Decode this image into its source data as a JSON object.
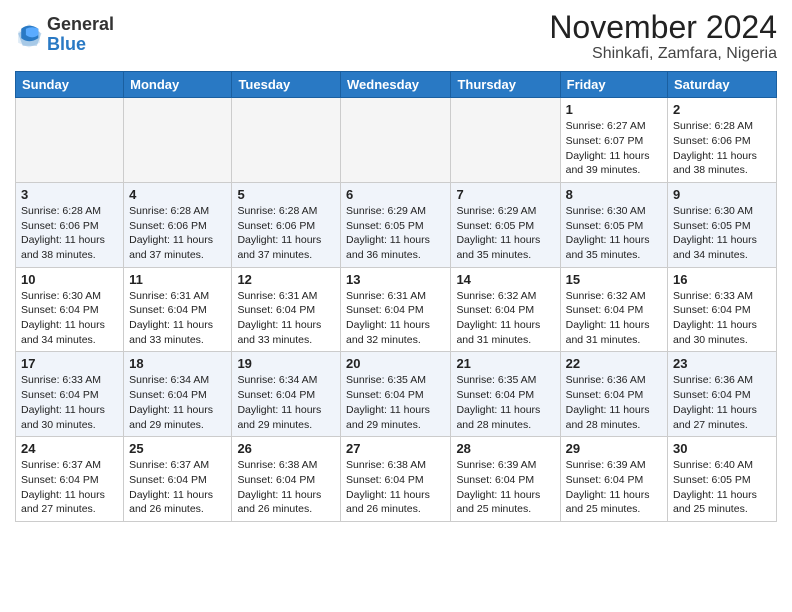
{
  "header": {
    "logo_general": "General",
    "logo_blue": "Blue",
    "month_year": "November 2024",
    "location": "Shinkafi, Zamfara, Nigeria"
  },
  "weekdays": [
    "Sunday",
    "Monday",
    "Tuesday",
    "Wednesday",
    "Thursday",
    "Friday",
    "Saturday"
  ],
  "weeks": [
    [
      {
        "day": "",
        "info": ""
      },
      {
        "day": "",
        "info": ""
      },
      {
        "day": "",
        "info": ""
      },
      {
        "day": "",
        "info": ""
      },
      {
        "day": "",
        "info": ""
      },
      {
        "day": "1",
        "info": "Sunrise: 6:27 AM\nSunset: 6:07 PM\nDaylight: 11 hours and 39 minutes."
      },
      {
        "day": "2",
        "info": "Sunrise: 6:28 AM\nSunset: 6:06 PM\nDaylight: 11 hours and 38 minutes."
      }
    ],
    [
      {
        "day": "3",
        "info": "Sunrise: 6:28 AM\nSunset: 6:06 PM\nDaylight: 11 hours and 38 minutes."
      },
      {
        "day": "4",
        "info": "Sunrise: 6:28 AM\nSunset: 6:06 PM\nDaylight: 11 hours and 37 minutes."
      },
      {
        "day": "5",
        "info": "Sunrise: 6:28 AM\nSunset: 6:06 PM\nDaylight: 11 hours and 37 minutes."
      },
      {
        "day": "6",
        "info": "Sunrise: 6:29 AM\nSunset: 6:05 PM\nDaylight: 11 hours and 36 minutes."
      },
      {
        "day": "7",
        "info": "Sunrise: 6:29 AM\nSunset: 6:05 PM\nDaylight: 11 hours and 35 minutes."
      },
      {
        "day": "8",
        "info": "Sunrise: 6:30 AM\nSunset: 6:05 PM\nDaylight: 11 hours and 35 minutes."
      },
      {
        "day": "9",
        "info": "Sunrise: 6:30 AM\nSunset: 6:05 PM\nDaylight: 11 hours and 34 minutes."
      }
    ],
    [
      {
        "day": "10",
        "info": "Sunrise: 6:30 AM\nSunset: 6:04 PM\nDaylight: 11 hours and 34 minutes."
      },
      {
        "day": "11",
        "info": "Sunrise: 6:31 AM\nSunset: 6:04 PM\nDaylight: 11 hours and 33 minutes."
      },
      {
        "day": "12",
        "info": "Sunrise: 6:31 AM\nSunset: 6:04 PM\nDaylight: 11 hours and 33 minutes."
      },
      {
        "day": "13",
        "info": "Sunrise: 6:31 AM\nSunset: 6:04 PM\nDaylight: 11 hours and 32 minutes."
      },
      {
        "day": "14",
        "info": "Sunrise: 6:32 AM\nSunset: 6:04 PM\nDaylight: 11 hours and 31 minutes."
      },
      {
        "day": "15",
        "info": "Sunrise: 6:32 AM\nSunset: 6:04 PM\nDaylight: 11 hours and 31 minutes."
      },
      {
        "day": "16",
        "info": "Sunrise: 6:33 AM\nSunset: 6:04 PM\nDaylight: 11 hours and 30 minutes."
      }
    ],
    [
      {
        "day": "17",
        "info": "Sunrise: 6:33 AM\nSunset: 6:04 PM\nDaylight: 11 hours and 30 minutes."
      },
      {
        "day": "18",
        "info": "Sunrise: 6:34 AM\nSunset: 6:04 PM\nDaylight: 11 hours and 29 minutes."
      },
      {
        "day": "19",
        "info": "Sunrise: 6:34 AM\nSunset: 6:04 PM\nDaylight: 11 hours and 29 minutes."
      },
      {
        "day": "20",
        "info": "Sunrise: 6:35 AM\nSunset: 6:04 PM\nDaylight: 11 hours and 29 minutes."
      },
      {
        "day": "21",
        "info": "Sunrise: 6:35 AM\nSunset: 6:04 PM\nDaylight: 11 hours and 28 minutes."
      },
      {
        "day": "22",
        "info": "Sunrise: 6:36 AM\nSunset: 6:04 PM\nDaylight: 11 hours and 28 minutes."
      },
      {
        "day": "23",
        "info": "Sunrise: 6:36 AM\nSunset: 6:04 PM\nDaylight: 11 hours and 27 minutes."
      }
    ],
    [
      {
        "day": "24",
        "info": "Sunrise: 6:37 AM\nSunset: 6:04 PM\nDaylight: 11 hours and 27 minutes."
      },
      {
        "day": "25",
        "info": "Sunrise: 6:37 AM\nSunset: 6:04 PM\nDaylight: 11 hours and 26 minutes."
      },
      {
        "day": "26",
        "info": "Sunrise: 6:38 AM\nSunset: 6:04 PM\nDaylight: 11 hours and 26 minutes."
      },
      {
        "day": "27",
        "info": "Sunrise: 6:38 AM\nSunset: 6:04 PM\nDaylight: 11 hours and 26 minutes."
      },
      {
        "day": "28",
        "info": "Sunrise: 6:39 AM\nSunset: 6:04 PM\nDaylight: 11 hours and 25 minutes."
      },
      {
        "day": "29",
        "info": "Sunrise: 6:39 AM\nSunset: 6:04 PM\nDaylight: 11 hours and 25 minutes."
      },
      {
        "day": "30",
        "info": "Sunrise: 6:40 AM\nSunset: 6:05 PM\nDaylight: 11 hours and 25 minutes."
      }
    ]
  ]
}
